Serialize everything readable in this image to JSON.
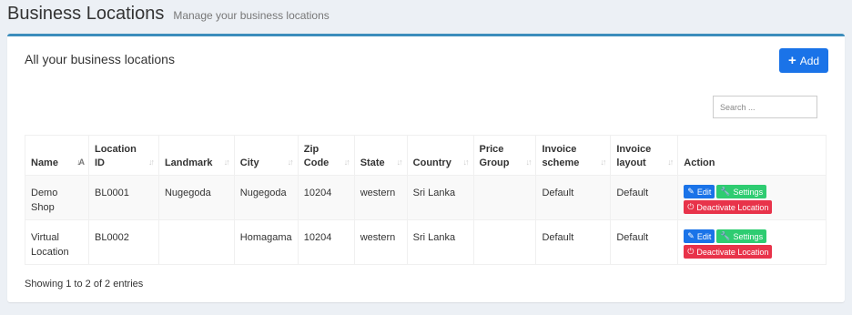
{
  "header": {
    "title": "Business Locations",
    "subtitle": "Manage your business locations"
  },
  "box": {
    "title": "All your business locations",
    "add_label": "Add"
  },
  "search": {
    "placeholder": "Search ..."
  },
  "table": {
    "columns": [
      "Name",
      "Location ID",
      "Landmark",
      "City",
      "Zip Code",
      "State",
      "Country",
      "Price Group",
      "Invoice scheme",
      "Invoice layout",
      "Action"
    ],
    "rows": [
      {
        "name": "Demo Shop",
        "location_id": "BL0001",
        "landmark": "Nugegoda",
        "city": "Nugegoda",
        "zip": "10204",
        "state": "western",
        "country": "Sri Lanka",
        "price_group": "",
        "invoice_scheme": "Default",
        "invoice_layout": "Default"
      },
      {
        "name": "Virtual Location",
        "location_id": "BL0002",
        "landmark": "",
        "city": "Homagama",
        "zip": "10204",
        "state": "western",
        "country": "Sri Lanka",
        "price_group": "",
        "invoice_scheme": "Default",
        "invoice_layout": "Default"
      }
    ],
    "actions": {
      "edit": "Edit",
      "settings": "Settings",
      "deactivate": "Deactivate Location"
    }
  },
  "footer": {
    "info": "Showing 1 to 2 of 2 entries"
  },
  "colors": {
    "primary": "#1a73e8",
    "success": "#2ecc71",
    "danger": "#e8334a",
    "box_border": "#3c8dbc"
  }
}
